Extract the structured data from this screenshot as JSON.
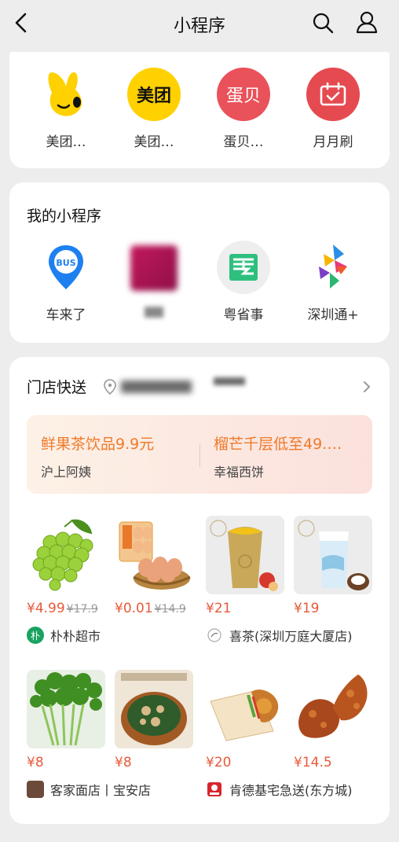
{
  "header": {
    "title": "小程序"
  },
  "recent_apps": [
    {
      "label": "美团…",
      "icon": "meituan-mascot-icon"
    },
    {
      "label": "美团…",
      "icon_text": "美团"
    },
    {
      "label": "蛋贝…",
      "icon_text": "蛋贝"
    },
    {
      "label": "月月刷",
      "icon": "calendar-check-icon"
    }
  ],
  "my_apps": {
    "title": "我的小程序",
    "items": [
      {
        "label": "车来了",
        "icon_text": "BUS"
      },
      {
        "label": "",
        "icon": "blurred-app-icon"
      },
      {
        "label": "粤省事",
        "icon": "yueshengshi-icon"
      },
      {
        "label": "深圳通+",
        "icon": "shenzhentong-icon"
      }
    ]
  },
  "store_delivery": {
    "title": "门店快送",
    "promos": [
      {
        "title": "鲜果茶饮品9.9元",
        "store": "沪上阿姨"
      },
      {
        "title": "榴芒千层低至49.…",
        "store": "幸福西饼"
      }
    ],
    "products": [
      {
        "price": "¥4.99",
        "old_price": "¥17.9",
        "image": "green-grapes"
      },
      {
        "price": "¥0.01",
        "old_price": "¥14.9",
        "image": "eggs-basket"
      },
      {
        "price": "¥21",
        "old_price": "",
        "image": "gold-tea-cup"
      },
      {
        "price": "¥19",
        "old_price": "",
        "image": "coconut-drink"
      },
      {
        "price": "¥8",
        "old_price": "",
        "image": "celery"
      },
      {
        "price": "¥8",
        "old_price": "",
        "image": "soup-pot"
      },
      {
        "price": "¥20",
        "old_price": "",
        "image": "wrap"
      },
      {
        "price": "¥14.5",
        "old_price": "",
        "image": "fried-wings"
      }
    ],
    "stores": [
      {
        "name": "朴朴超市",
        "badge": "朴",
        "color": "#1aa260"
      },
      {
        "name": "喜茶(深圳万庭大厦店)",
        "icon": "heytea-icon"
      },
      {
        "name": "客家面店丨宝安店",
        "icon": "noodle-shop-icon"
      },
      {
        "name": "肯德基宅急送(东方城)",
        "icon": "kfc-icon"
      }
    ]
  },
  "colors": {
    "price": "#e65a3a",
    "promo_title": "#ef7a2b",
    "meituan_yellow": "#ffd100",
    "red_app": "#e9525a"
  }
}
